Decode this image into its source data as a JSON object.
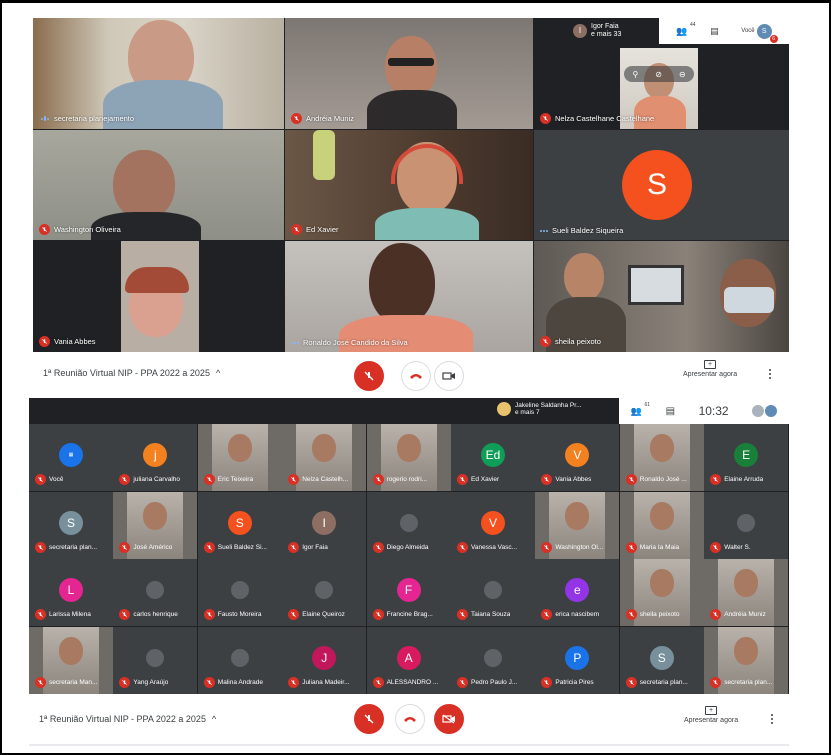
{
  "panel1": {
    "others_label_line1": "Igor Faia",
    "others_label_line2": "e mais 33",
    "others_initial": "I",
    "people_count": "44",
    "you_label": "Você",
    "you_initial": "S",
    "you_badge": "6",
    "tiles": [
      {
        "name": "secretaria planejamento",
        "status": "speaking"
      },
      {
        "name": "Andréia Muniz",
        "status": "muted"
      },
      {
        "name": "Nelza Castelhane Castelhane",
        "status": "muted"
      },
      {
        "name": "Washington Oliveira",
        "status": "muted"
      },
      {
        "name": "Ed Xavier",
        "status": "muted"
      },
      {
        "name": "Sueli Baldez Siqueira",
        "status": "dots",
        "initial": "S"
      },
      {
        "name": "Vania Abbes",
        "status": "muted"
      },
      {
        "name": "Ronaldo José Candido da Silva",
        "status": "dots"
      },
      {
        "name": "sheila peixoto",
        "status": "muted"
      }
    ],
    "meeting_title": "1ª Reunião Virtual NIP - PPA 2022 a 2025",
    "present_label": "Apresentar agora"
  },
  "panel2": {
    "others_label_line1": "Jakeline Saldanha Pr...",
    "others_label_line2": "e mais 7",
    "people_count": "61",
    "clock": "10:32",
    "cells": [
      {
        "name": "Você",
        "initial": "",
        "color": "#1a73e8",
        "photo": false,
        "logo": true
      },
      {
        "name": "juliana Carvalho",
        "initial": "j",
        "color": "#f4811f",
        "photo": false
      },
      {
        "name": "Eric Teixeira",
        "initial": "",
        "color": "#5f6368",
        "photo": true
      },
      {
        "name": "Nelza Castelh...",
        "initial": "",
        "color": "#5f6368",
        "photo": true
      },
      {
        "name": "rogerio rodri...",
        "initial": "",
        "color": "#5f6368",
        "photo": true
      },
      {
        "name": "Ed Xavier",
        "initial": "Ed",
        "color": "#0f9d58",
        "photo": false
      },
      {
        "name": "Vania Abbes",
        "initial": "V",
        "color": "#f4811f",
        "photo": false
      },
      {
        "name": "Ronaldo José ...",
        "initial": "",
        "color": "#5f6368",
        "photo": true
      },
      {
        "name": "Elaine Arruda",
        "initial": "E",
        "color": "#188038",
        "photo": false
      },
      {
        "name": "secretaria plan...",
        "initial": "S",
        "color": "#78909c",
        "photo": false
      },
      {
        "name": "José Américo",
        "initial": "",
        "color": "#5f6368",
        "photo": true
      },
      {
        "name": "Sueli Baldez Si...",
        "initial": "S",
        "color": "#f4511e",
        "photo": false
      },
      {
        "name": "Igor Faia",
        "initial": "I",
        "color": "#8d6e63",
        "photo": false
      },
      {
        "name": "Diego Almeida",
        "initial": "",
        "color": "#5f6368",
        "photo": false,
        "small": true
      },
      {
        "name": "Vanessa Vasc...",
        "initial": "V",
        "color": "#f4511e",
        "photo": false
      },
      {
        "name": "Washington Ol...",
        "initial": "",
        "color": "#5f6368",
        "photo": true
      },
      {
        "name": "Maria Ia Maia",
        "initial": "",
        "color": "#5f6368",
        "photo": true
      },
      {
        "name": "Walter S.",
        "initial": "",
        "color": "#5f6368",
        "photo": false,
        "small": true
      },
      {
        "name": "Larissa Milena",
        "initial": "L",
        "color": "#e52592",
        "photo": false
      },
      {
        "name": "carlos henrique",
        "initial": "",
        "color": "#5f6368",
        "photo": false,
        "small": true
      },
      {
        "name": "Fausto Moreira",
        "initial": "",
        "color": "#5f6368",
        "photo": false,
        "small": true
      },
      {
        "name": "Elaine Queiroz",
        "initial": "",
        "color": "#5f6368",
        "photo": false,
        "small": true
      },
      {
        "name": "Francine Brag...",
        "initial": "F",
        "color": "#e52592",
        "photo": false
      },
      {
        "name": "Taiana Souza",
        "initial": "",
        "color": "#5f6368",
        "photo": false,
        "small": true
      },
      {
        "name": "erica nascibem",
        "initial": "e",
        "color": "#9334e6",
        "photo": false
      },
      {
        "name": "sheila peixoto",
        "initial": "",
        "color": "#5f6368",
        "photo": true
      },
      {
        "name": "Andréia Muniz",
        "initial": "",
        "color": "#5f6368",
        "photo": true
      },
      {
        "name": "secretaria Man...",
        "initial": "",
        "color": "#5f6368",
        "photo": true
      },
      {
        "name": "Yang Araújo",
        "initial": "",
        "color": "#5f6368",
        "photo": false,
        "small": true
      },
      {
        "name": "Malina Andrade",
        "initial": "",
        "color": "#5f6368",
        "photo": false,
        "small": true
      },
      {
        "name": "Juliana Madeir...",
        "initial": "J",
        "color": "#c2185b",
        "photo": false
      },
      {
        "name": "ALESSANDRO ...",
        "initial": "A",
        "color": "#d81b60",
        "photo": false
      },
      {
        "name": "Pedro Paulo J...",
        "initial": "",
        "color": "#5f6368",
        "photo": false,
        "small": true
      },
      {
        "name": "Patricia Pires",
        "initial": "P",
        "color": "#1a73e8",
        "photo": false
      },
      {
        "name": "secretaria plan...",
        "initial": "S",
        "color": "#78909c",
        "photo": false
      },
      {
        "name": "secretaria plan...",
        "initial": "",
        "color": "#5f6368",
        "photo": true
      }
    ],
    "meeting_title": "1ª Reunião Virtual NIP - PPA 2022 a 2025",
    "present_label": "Apresentar agora"
  }
}
